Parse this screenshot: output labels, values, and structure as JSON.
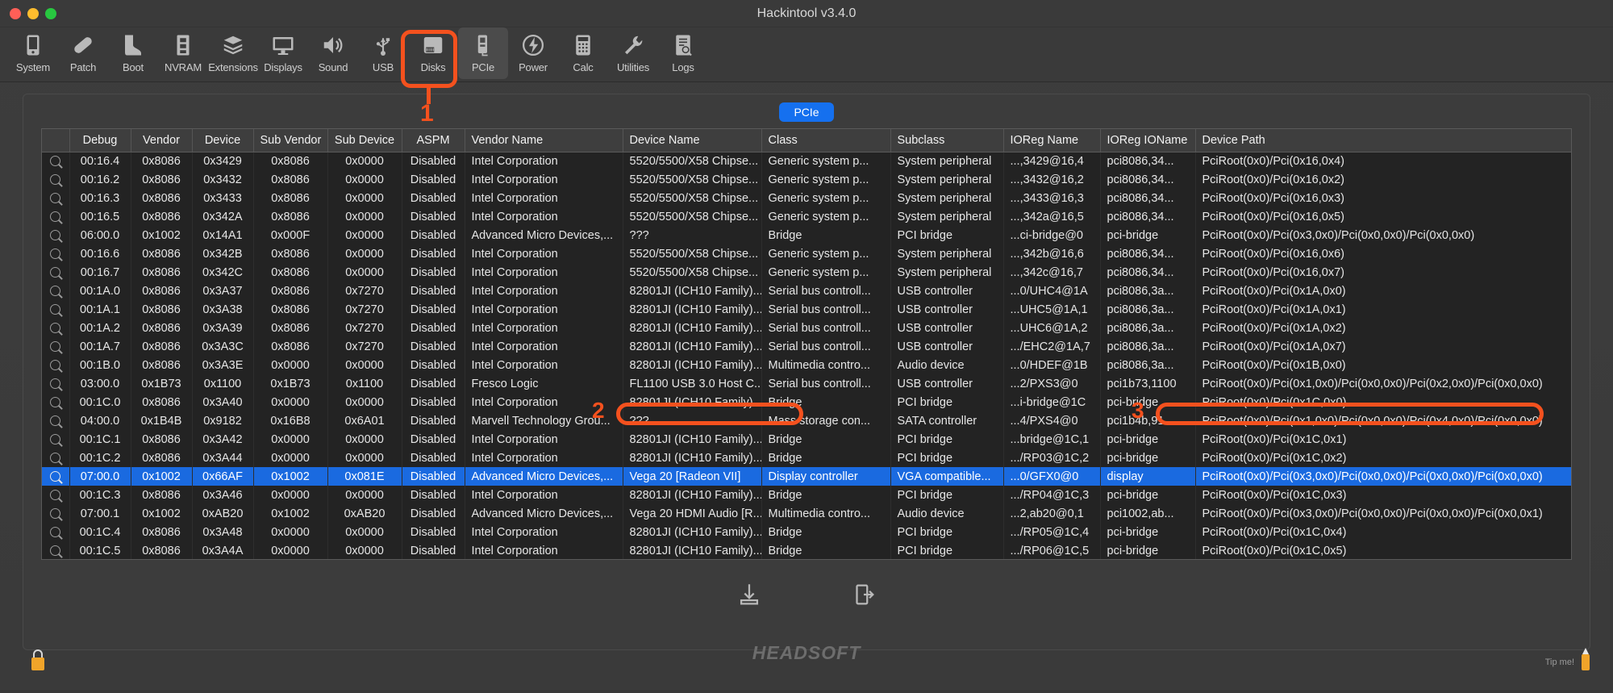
{
  "window": {
    "title": "Hackintool v3.4.0",
    "traffic_lights": [
      "close",
      "minimize",
      "zoom"
    ]
  },
  "toolbar": {
    "items": [
      {
        "label": "System",
        "icon": "system-icon",
        "active": false
      },
      {
        "label": "Patch",
        "icon": "patch-icon",
        "active": false
      },
      {
        "label": "Boot",
        "icon": "boot-icon",
        "active": false
      },
      {
        "label": "NVRAM",
        "icon": "nvram-icon",
        "active": false
      },
      {
        "label": "Extensions",
        "icon": "extensions-icon",
        "active": false
      },
      {
        "label": "Displays",
        "icon": "displays-icon",
        "active": false
      },
      {
        "label": "Sound",
        "icon": "sound-icon",
        "active": false
      },
      {
        "label": "USB",
        "icon": "usb-icon",
        "active": false
      },
      {
        "label": "Disks",
        "icon": "disks-icon",
        "active": false
      },
      {
        "label": "PCIe",
        "icon": "pcie-icon",
        "active": true
      },
      {
        "label": "Power",
        "icon": "power-icon",
        "active": false
      },
      {
        "label": "Calc",
        "icon": "calc-icon",
        "active": false
      },
      {
        "label": "Utilities",
        "icon": "utilities-icon",
        "active": false
      },
      {
        "label": "Logs",
        "icon": "logs-icon",
        "active": false
      }
    ]
  },
  "tab": {
    "label": "PCIe"
  },
  "annotations": [
    {
      "id": "1",
      "label": "1",
      "target": "pcie-toolbar-button"
    },
    {
      "id": "2",
      "label": "2",
      "target": "device-name-cell-selected"
    },
    {
      "id": "3",
      "label": "3",
      "target": "device-path-cell-selected"
    }
  ],
  "table": {
    "columns": [
      {
        "key": "debug_icon",
        "label": ""
      },
      {
        "key": "debug",
        "label": "Debug"
      },
      {
        "key": "vendor",
        "label": "Vendor"
      },
      {
        "key": "device",
        "label": "Device"
      },
      {
        "key": "sub_vendor",
        "label": "Sub Vendor"
      },
      {
        "key": "sub_device",
        "label": "Sub Device"
      },
      {
        "key": "aspm",
        "label": "ASPM"
      },
      {
        "key": "vendor_name",
        "label": "Vendor Name"
      },
      {
        "key": "device_name",
        "label": "Device Name"
      },
      {
        "key": "class",
        "label": "Class"
      },
      {
        "key": "subclass",
        "label": "Subclass"
      },
      {
        "key": "ioreg_name",
        "label": "IOReg Name"
      },
      {
        "key": "ioreg_ioname",
        "label": "IOReg IOName"
      },
      {
        "key": "device_path",
        "label": "Device Path"
      }
    ],
    "rows": [
      {
        "selected": false,
        "debug": "00:16.4",
        "vendor": "0x8086",
        "device": "0x3429",
        "sub_vendor": "0x8086",
        "sub_device": "0x0000",
        "aspm": "Disabled",
        "vendor_name": "Intel Corporation",
        "device_name": "5520/5500/X58 Chipse...",
        "class": "Generic system p...",
        "subclass": "System peripheral",
        "ioreg_name": "...,3429@16,4",
        "ioreg_ioname": "pci8086,34...",
        "device_path": "PciRoot(0x0)/Pci(0x16,0x4)"
      },
      {
        "selected": false,
        "debug": "00:16.2",
        "vendor": "0x8086",
        "device": "0x3432",
        "sub_vendor": "0x8086",
        "sub_device": "0x0000",
        "aspm": "Disabled",
        "vendor_name": "Intel Corporation",
        "device_name": "5520/5500/X58 Chipse...",
        "class": "Generic system p...",
        "subclass": "System peripheral",
        "ioreg_name": "...,3432@16,2",
        "ioreg_ioname": "pci8086,34...",
        "device_path": "PciRoot(0x0)/Pci(0x16,0x2)"
      },
      {
        "selected": false,
        "debug": "00:16.3",
        "vendor": "0x8086",
        "device": "0x3433",
        "sub_vendor": "0x8086",
        "sub_device": "0x0000",
        "aspm": "Disabled",
        "vendor_name": "Intel Corporation",
        "device_name": "5520/5500/X58 Chipse...",
        "class": "Generic system p...",
        "subclass": "System peripheral",
        "ioreg_name": "...,3433@16,3",
        "ioreg_ioname": "pci8086,34...",
        "device_path": "PciRoot(0x0)/Pci(0x16,0x3)"
      },
      {
        "selected": false,
        "debug": "00:16.5",
        "vendor": "0x8086",
        "device": "0x342A",
        "sub_vendor": "0x8086",
        "sub_device": "0x0000",
        "aspm": "Disabled",
        "vendor_name": "Intel Corporation",
        "device_name": "5520/5500/X58 Chipse...",
        "class": "Generic system p...",
        "subclass": "System peripheral",
        "ioreg_name": "...,342a@16,5",
        "ioreg_ioname": "pci8086,34...",
        "device_path": "PciRoot(0x0)/Pci(0x16,0x5)"
      },
      {
        "selected": false,
        "debug": "06:00.0",
        "vendor": "0x1002",
        "device": "0x14A1",
        "sub_vendor": "0x000F",
        "sub_device": "0x0000",
        "aspm": "Disabled",
        "vendor_name": "Advanced Micro Devices,...",
        "device_name": "???",
        "class": "Bridge",
        "subclass": "PCI bridge",
        "ioreg_name": "...ci-bridge@0",
        "ioreg_ioname": "pci-bridge",
        "device_path": "PciRoot(0x0)/Pci(0x3,0x0)/Pci(0x0,0x0)/Pci(0x0,0x0)"
      },
      {
        "selected": false,
        "debug": "00:16.6",
        "vendor": "0x8086",
        "device": "0x342B",
        "sub_vendor": "0x8086",
        "sub_device": "0x0000",
        "aspm": "Disabled",
        "vendor_name": "Intel Corporation",
        "device_name": "5520/5500/X58 Chipse...",
        "class": "Generic system p...",
        "subclass": "System peripheral",
        "ioreg_name": "...,342b@16,6",
        "ioreg_ioname": "pci8086,34...",
        "device_path": "PciRoot(0x0)/Pci(0x16,0x6)"
      },
      {
        "selected": false,
        "debug": "00:16.7",
        "vendor": "0x8086",
        "device": "0x342C",
        "sub_vendor": "0x8086",
        "sub_device": "0x0000",
        "aspm": "Disabled",
        "vendor_name": "Intel Corporation",
        "device_name": "5520/5500/X58 Chipse...",
        "class": "Generic system p...",
        "subclass": "System peripheral",
        "ioreg_name": "...,342c@16,7",
        "ioreg_ioname": "pci8086,34...",
        "device_path": "PciRoot(0x0)/Pci(0x16,0x7)"
      },
      {
        "selected": false,
        "debug": "00:1A.0",
        "vendor": "0x8086",
        "device": "0x3A37",
        "sub_vendor": "0x8086",
        "sub_device": "0x7270",
        "aspm": "Disabled",
        "vendor_name": "Intel Corporation",
        "device_name": "82801JI (ICH10 Family)...",
        "class": "Serial bus controll...",
        "subclass": "USB controller",
        "ioreg_name": "...0/UHC4@1A",
        "ioreg_ioname": "pci8086,3a...",
        "device_path": "PciRoot(0x0)/Pci(0x1A,0x0)"
      },
      {
        "selected": false,
        "debug": "00:1A.1",
        "vendor": "0x8086",
        "device": "0x3A38",
        "sub_vendor": "0x8086",
        "sub_device": "0x7270",
        "aspm": "Disabled",
        "vendor_name": "Intel Corporation",
        "device_name": "82801JI (ICH10 Family)...",
        "class": "Serial bus controll...",
        "subclass": "USB controller",
        "ioreg_name": "...UHC5@1A,1",
        "ioreg_ioname": "pci8086,3a...",
        "device_path": "PciRoot(0x0)/Pci(0x1A,0x1)"
      },
      {
        "selected": false,
        "debug": "00:1A.2",
        "vendor": "0x8086",
        "device": "0x3A39",
        "sub_vendor": "0x8086",
        "sub_device": "0x7270",
        "aspm": "Disabled",
        "vendor_name": "Intel Corporation",
        "device_name": "82801JI (ICH10 Family)...",
        "class": "Serial bus controll...",
        "subclass": "USB controller",
        "ioreg_name": "...UHC6@1A,2",
        "ioreg_ioname": "pci8086,3a...",
        "device_path": "PciRoot(0x0)/Pci(0x1A,0x2)"
      },
      {
        "selected": false,
        "debug": "00:1A.7",
        "vendor": "0x8086",
        "device": "0x3A3C",
        "sub_vendor": "0x8086",
        "sub_device": "0x7270",
        "aspm": "Disabled",
        "vendor_name": "Intel Corporation",
        "device_name": "82801JI (ICH10 Family)...",
        "class": "Serial bus controll...",
        "subclass": "USB controller",
        "ioreg_name": ".../EHC2@1A,7",
        "ioreg_ioname": "pci8086,3a...",
        "device_path": "PciRoot(0x0)/Pci(0x1A,0x7)"
      },
      {
        "selected": false,
        "debug": "00:1B.0",
        "vendor": "0x8086",
        "device": "0x3A3E",
        "sub_vendor": "0x0000",
        "sub_device": "0x0000",
        "aspm": "Disabled",
        "vendor_name": "Intel Corporation",
        "device_name": "82801JI (ICH10 Family)...",
        "class": "Multimedia contro...",
        "subclass": "Audio device",
        "ioreg_name": "...0/HDEF@1B",
        "ioreg_ioname": "pci8086,3a...",
        "device_path": "PciRoot(0x0)/Pci(0x1B,0x0)"
      },
      {
        "selected": false,
        "debug": "03:00.0",
        "vendor": "0x1B73",
        "device": "0x1100",
        "sub_vendor": "0x1B73",
        "sub_device": "0x1100",
        "aspm": "Disabled",
        "vendor_name": "Fresco Logic",
        "device_name": "FL1100 USB 3.0 Host C...",
        "class": "Serial bus controll...",
        "subclass": "USB controller",
        "ioreg_name": "...2/PXS3@0",
        "ioreg_ioname": "pci1b73,1100",
        "device_path": "PciRoot(0x0)/Pci(0x1,0x0)/Pci(0x0,0x0)/Pci(0x2,0x0)/Pci(0x0,0x0)"
      },
      {
        "selected": false,
        "debug": "00:1C.0",
        "vendor": "0x8086",
        "device": "0x3A40",
        "sub_vendor": "0x0000",
        "sub_device": "0x0000",
        "aspm": "Disabled",
        "vendor_name": "Intel Corporation",
        "device_name": "82801JI (ICH10 Family)...",
        "class": "Bridge",
        "subclass": "PCI bridge",
        "ioreg_name": "...i-bridge@1C",
        "ioreg_ioname": "pci-bridge",
        "device_path": "PciRoot(0x0)/Pci(0x1C,0x0)"
      },
      {
        "selected": false,
        "debug": "04:00.0",
        "vendor": "0x1B4B",
        "device": "0x9182",
        "sub_vendor": "0x16B8",
        "sub_device": "0x6A01",
        "aspm": "Disabled",
        "vendor_name": "Marvell Technology Grou...",
        "device_name": "???",
        "class": "Mass storage con...",
        "subclass": "SATA controller",
        "ioreg_name": "...4/PXS4@0",
        "ioreg_ioname": "pci1b4b,91...",
        "device_path": "PciRoot(0x0)/Pci(0x1,0x0)/Pci(0x0,0x0)/Pci(0x4,0x0)/Pci(0x0,0x0)"
      },
      {
        "selected": false,
        "debug": "00:1C.1",
        "vendor": "0x8086",
        "device": "0x3A42",
        "sub_vendor": "0x0000",
        "sub_device": "0x0000",
        "aspm": "Disabled",
        "vendor_name": "Intel Corporation",
        "device_name": "82801JI (ICH10 Family)...",
        "class": "Bridge",
        "subclass": "PCI bridge",
        "ioreg_name": "...bridge@1C,1",
        "ioreg_ioname": "pci-bridge",
        "device_path": "PciRoot(0x0)/Pci(0x1C,0x1)"
      },
      {
        "selected": false,
        "debug": "00:1C.2",
        "vendor": "0x8086",
        "device": "0x3A44",
        "sub_vendor": "0x0000",
        "sub_device": "0x0000",
        "aspm": "Disabled",
        "vendor_name": "Intel Corporation",
        "device_name": "82801JI (ICH10 Family)...",
        "class": "Bridge",
        "subclass": "PCI bridge",
        "ioreg_name": ".../RP03@1C,2",
        "ioreg_ioname": "pci-bridge",
        "device_path": "PciRoot(0x0)/Pci(0x1C,0x2)"
      },
      {
        "selected": true,
        "debug": "07:00.0",
        "vendor": "0x1002",
        "device": "0x66AF",
        "sub_vendor": "0x1002",
        "sub_device": "0x081E",
        "aspm": "Disabled",
        "vendor_name": "Advanced Micro Devices,...",
        "device_name": "Vega 20 [Radeon VII]",
        "class": "Display controller",
        "subclass": "VGA compatible...",
        "ioreg_name": "...0/GFX0@0",
        "ioreg_ioname": "display",
        "device_path": "PciRoot(0x0)/Pci(0x3,0x0)/Pci(0x0,0x0)/Pci(0x0,0x0)/Pci(0x0,0x0)"
      },
      {
        "selected": false,
        "debug": "00:1C.3",
        "vendor": "0x8086",
        "device": "0x3A46",
        "sub_vendor": "0x0000",
        "sub_device": "0x0000",
        "aspm": "Disabled",
        "vendor_name": "Intel Corporation",
        "device_name": "82801JI (ICH10 Family)...",
        "class": "Bridge",
        "subclass": "PCI bridge",
        "ioreg_name": ".../RP04@1C,3",
        "ioreg_ioname": "pci-bridge",
        "device_path": "PciRoot(0x0)/Pci(0x1C,0x3)"
      },
      {
        "selected": false,
        "debug": "07:00.1",
        "vendor": "0x1002",
        "device": "0xAB20",
        "sub_vendor": "0x1002",
        "sub_device": "0xAB20",
        "aspm": "Disabled",
        "vendor_name": "Advanced Micro Devices,...",
        "device_name": "Vega 20 HDMI Audio [R...",
        "class": "Multimedia contro...",
        "subclass": "Audio device",
        "ioreg_name": "...2,ab20@0,1",
        "ioreg_ioname": "pci1002,ab...",
        "device_path": "PciRoot(0x0)/Pci(0x3,0x0)/Pci(0x0,0x0)/Pci(0x0,0x0)/Pci(0x0,0x1)"
      },
      {
        "selected": false,
        "debug": "00:1C.4",
        "vendor": "0x8086",
        "device": "0x3A48",
        "sub_vendor": "0x0000",
        "sub_device": "0x0000",
        "aspm": "Disabled",
        "vendor_name": "Intel Corporation",
        "device_name": "82801JI (ICH10 Family)...",
        "class": "Bridge",
        "subclass": "PCI bridge",
        "ioreg_name": ".../RP05@1C,4",
        "ioreg_ioname": "pci-bridge",
        "device_path": "PciRoot(0x0)/Pci(0x1C,0x4)"
      },
      {
        "selected": false,
        "debug": "00:1C.5",
        "vendor": "0x8086",
        "device": "0x3A4A",
        "sub_vendor": "0x0000",
        "sub_device": "0x0000",
        "aspm": "Disabled",
        "vendor_name": "Intel Corporation",
        "device_name": "82801JI (ICH10 Family)...",
        "class": "Bridge",
        "subclass": "PCI bridge",
        "ioreg_name": ".../RP06@1C,5",
        "ioreg_ioname": "pci-bridge",
        "device_path": "PciRoot(0x0)/Pci(0x1C,0x5)"
      }
    ]
  },
  "actions": [
    {
      "name": "export-button",
      "icon": "download-icon"
    },
    {
      "name": "open-button",
      "icon": "export-icon"
    }
  ],
  "footer": {
    "brand": "HEADSOFT",
    "tip_label": "Tip me!",
    "lock_icon": "lock-icon",
    "bulb_icon": "bulb-icon"
  },
  "colors": {
    "accent_blue": "#1a6ae0",
    "annotation_orange": "#f4511e",
    "tab_blue": "#1570ef"
  }
}
